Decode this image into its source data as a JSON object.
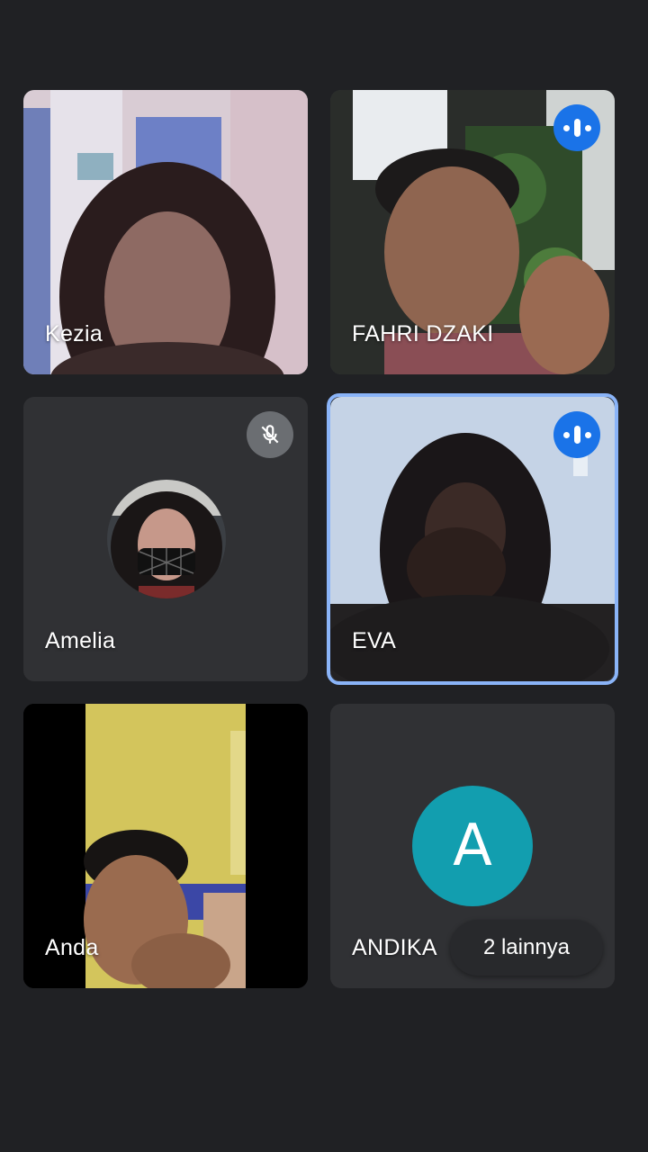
{
  "participants": [
    {
      "name": "Kezia",
      "state": "video"
    },
    {
      "name": "FAHRI DZAKI",
      "state": "video",
      "speaking_icon": "audio-level-icon"
    },
    {
      "name": "Amelia",
      "state": "avatar",
      "muted_icon": "mic-off-icon"
    },
    {
      "name": "EVA",
      "state": "video",
      "speaking_icon": "audio-level-icon",
      "active_speaker": true
    },
    {
      "name": "Anda",
      "state": "video"
    },
    {
      "name": "ANDIKA",
      "state": "letter-avatar",
      "avatar_letter": "A"
    }
  ],
  "more": {
    "label": "2 lainnya"
  },
  "colors": {
    "background": "#202124",
    "tile": "#303134",
    "speaking_badge": "#1a73e8",
    "active_border": "#8ab4f8",
    "letter_avatar": "#129eaf",
    "muted_badge": "#6b6e72"
  }
}
